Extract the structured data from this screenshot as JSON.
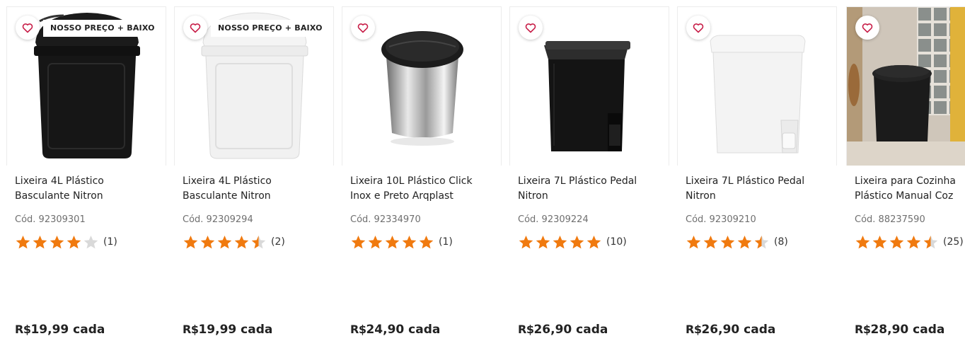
{
  "products": [
    {
      "title_line1": "Lixeira 4L Plástico",
      "title_line2": "Basculante Nitron",
      "code": "Cód. 92309301",
      "rating": 4,
      "review_count": "(1)",
      "currency": "R$",
      "price": "19,99 cada",
      "badge": "NOSSO PREÇO + BAIXO",
      "image": "black-trash-bin-swing-lid"
    },
    {
      "title_line1": "Lixeira 4L Plástico",
      "title_line2": "Basculante Nitron",
      "code": "Cód. 92309294",
      "rating": 4.5,
      "review_count": "(2)",
      "currency": "R$",
      "price": "19,99 cada",
      "badge": "NOSSO PREÇO + BAIXO",
      "image": "white-trash-bin-swing-lid"
    },
    {
      "title_line1": "Lixeira 10L Plástico Click",
      "title_line2": "Inox e Preto Arqplast",
      "code": "Cód. 92334970",
      "rating": 5,
      "review_count": "(1)",
      "currency": "R$",
      "price": "24,90 cada",
      "badge": "",
      "image": "steel-trash-bin-click-lid"
    },
    {
      "title_line1": "Lixeira 7L Plástico Pedal",
      "title_line2": "Nitron",
      "code": "Cód. 92309224",
      "rating": 5,
      "review_count": "(10)",
      "currency": "R$",
      "price": "26,90 cada",
      "badge": "",
      "image": "black-pedal-trash-bin"
    },
    {
      "title_line1": "Lixeira 7L Plástico Pedal",
      "title_line2": "Nitron",
      "code": "Cód. 92309210",
      "rating": 4.5,
      "review_count": "(8)",
      "currency": "R$",
      "price": "26,90 cada",
      "badge": "",
      "image": "white-pedal-trash-bin"
    },
    {
      "title_line1": "Lixeira para Cozinha",
      "title_line2": "Plástico Manual Coz",
      "code": "Cód. 88237590",
      "rating": 4.5,
      "review_count": "(25)",
      "currency": "R$",
      "price": "28,90 cada",
      "badge": "",
      "image": "black-kitchen-trash-bin-scene"
    }
  ],
  "colors": {
    "star": "#F07A0F",
    "star_empty": "#D9D9D9",
    "heart": "#C81E48",
    "text": "#222222",
    "muted": "#6F6F6F"
  }
}
